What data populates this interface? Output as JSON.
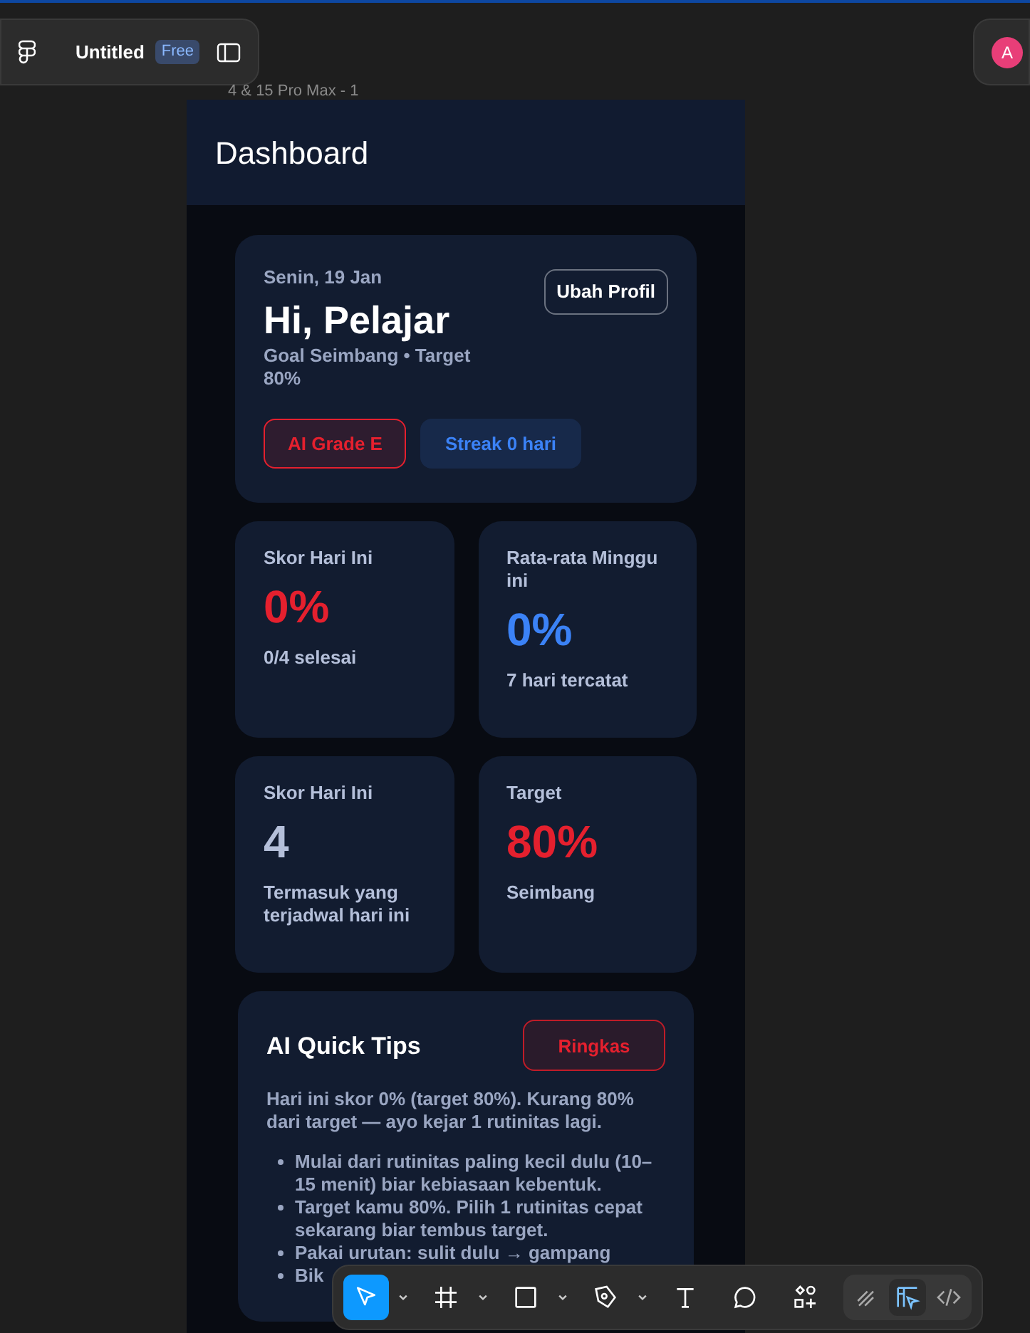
{
  "editor": {
    "file_name": "Untitled",
    "plan_badge": "Free",
    "avatar_initial": "A",
    "frame_label": "4 & 15 Pro Max - 1"
  },
  "header": {
    "title": "Dashboard"
  },
  "profile_card": {
    "date": "Senin, 19 Jan",
    "greeting": "Hi, Pelajar",
    "goal": "Goal Seimbang • Target 80%",
    "edit_button": "Ubah Profil",
    "badges": [
      {
        "label": "AI Grade E",
        "color": "#e5202e"
      },
      {
        "label": "Streak 0 hari",
        "color": "#3b82f6"
      }
    ]
  },
  "stats": [
    {
      "title": "Skor Hari Ini",
      "value": "0%",
      "color": "#e5202e",
      "caption": "0/4 selesai"
    },
    {
      "title": "Rata-rata Minggu ini",
      "value": "0%",
      "color": "#3b82f6",
      "caption": "7 hari tercatat"
    },
    {
      "title": "Skor Hari Ini",
      "value": "4",
      "color": "#b4bfd9",
      "caption": "Termasuk yang terjadwal hari ini"
    },
    {
      "title": "Target",
      "value": "80%",
      "color": "#e5202e",
      "caption": "Seimbang"
    }
  ],
  "tips": {
    "title": "AI Quick Tips",
    "button": "Ringkas",
    "summary": "Hari ini skor 0% (target 80%). Kurang 80% dari target — ayo kejar 1 rutinitas lagi.",
    "items": [
      "Mulai dari rutinitas paling kecil dulu (10–15 menit) biar kebiasaan kebentuk.",
      "Target kamu 80%. Pilih 1 rutinitas cepat sekarang biar tembus target.",
      "Pakai urutan: sulit dulu → gampang",
      "Bik"
    ]
  },
  "toolbar": {
    "tools": [
      {
        "kind": "move",
        "selected": true,
        "menu": true
      },
      {
        "kind": "frame",
        "selected": false,
        "menu": true
      },
      {
        "kind": "rect",
        "selected": false,
        "menu": true
      },
      {
        "kind": "pen",
        "selected": false,
        "menu": true
      },
      {
        "kind": "text",
        "selected": false,
        "menu": false
      },
      {
        "kind": "comment",
        "selected": false,
        "menu": false
      },
      {
        "kind": "assets",
        "selected": false,
        "menu": false
      }
    ],
    "modes": [
      {
        "kind": "draw",
        "selected": false
      },
      {
        "kind": "design",
        "selected": true
      },
      {
        "kind": "dev",
        "selected": false
      }
    ]
  }
}
